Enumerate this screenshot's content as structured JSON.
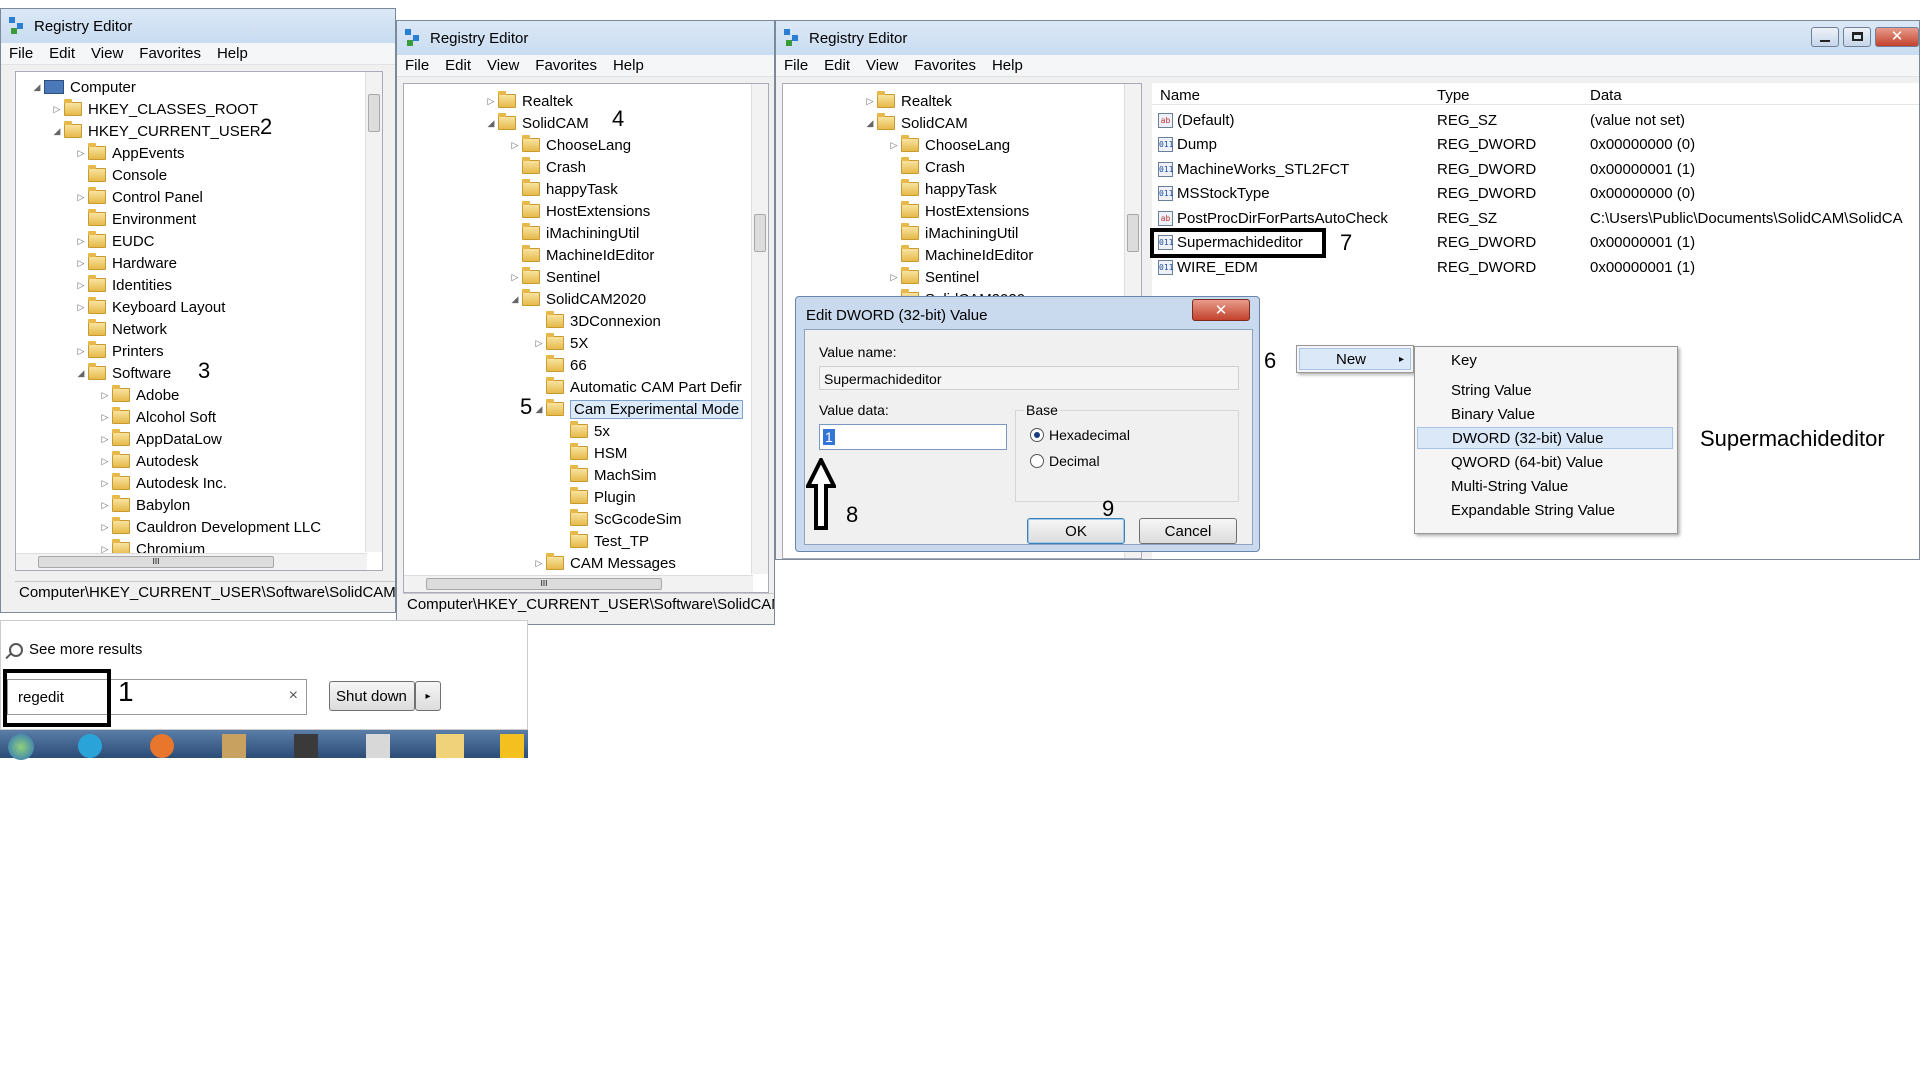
{
  "win1": {
    "title": "Registry Editor",
    "menu": [
      "File",
      "Edit",
      "View",
      "Favorites",
      "Help"
    ],
    "tree": [
      "Computer",
      "HKEY_CLASSES_ROOT",
      "HKEY_CURRENT_USER",
      "AppEvents",
      "Console",
      "Control Panel",
      "Environment",
      "EUDC",
      "Hardware",
      "Identities",
      "Keyboard Layout",
      "Network",
      "Printers",
      "Software",
      "Adobe",
      "Alcohol Soft",
      "AppDataLow",
      "Autodesk",
      "Autodesk Inc.",
      "Babylon",
      "Cauldron Development LLC",
      "Chromium"
    ],
    "status": "Computer\\HKEY_CURRENT_USER\\Software\\SolidCAM\\S",
    "scroll_mark": "III"
  },
  "win2": {
    "title": "Registry Editor",
    "menu": [
      "File",
      "Edit",
      "View",
      "Favorites",
      "Help"
    ],
    "tree": [
      "Realtek",
      "SolidCAM",
      "ChooseLang",
      "Crash",
      "happyTask",
      "HostExtensions",
      "iMachiningUtil",
      "MachineIdEditor",
      "Sentinel",
      "SolidCAM2020",
      "3DConnexion",
      "5X",
      "66",
      "Automatic CAM Part Defir",
      "Cam Experimental Mode",
      "5x",
      "HSM",
      "MachSim",
      "Plugin",
      "ScGcodeSim",
      "Test_TP",
      "CAM Messages"
    ],
    "status": "Computer\\HKEY_CURRENT_USER\\Software\\SolidCAM\\S",
    "scroll_mark": "III"
  },
  "win3": {
    "title": "Registry Editor",
    "menu": [
      "File",
      "Edit",
      "View",
      "Favorites",
      "Help"
    ],
    "tree": [
      "Realtek",
      "SolidCAM",
      "ChooseLang",
      "Crash",
      "happyTask",
      "HostExtensions",
      "iMachiningUtil",
      "MachineIdEditor",
      "Sentinel",
      "SolidCAM2020"
    ],
    "columns": [
      "Name",
      "Type",
      "Data"
    ],
    "values": [
      {
        "icon": "ab",
        "name": "(Default)",
        "type": "REG_SZ",
        "data": "(value not set)"
      },
      {
        "icon": "011",
        "name": "Dump",
        "type": "REG_DWORD",
        "data": "0x00000000 (0)"
      },
      {
        "icon": "011",
        "name": "MachineWorks_STL2FCT",
        "type": "REG_DWORD",
        "data": "0x00000001 (1)"
      },
      {
        "icon": "011",
        "name": "MSStockType",
        "type": "REG_DWORD",
        "data": "0x00000000 (0)"
      },
      {
        "icon": "ab",
        "name": "PostProcDirForPartsAutoCheck",
        "type": "REG_SZ",
        "data": "C:\\Users\\Public\\Documents\\SolidCAM\\SolidCA"
      },
      {
        "icon": "011",
        "name": "Supermachideditor",
        "type": "REG_DWORD",
        "data": "0x00000001 (1)"
      },
      {
        "icon": "011",
        "name": "WIRE_EDM",
        "type": "REG_DWORD",
        "data": "0x00000001 (1)"
      }
    ],
    "caption_buttons": [
      "minimize",
      "maximize",
      "close"
    ]
  },
  "dialog": {
    "title": "Edit DWORD (32-bit) Value",
    "value_name_label": "Value name:",
    "value_name": "Supermachideditor",
    "value_data_label": "Value data:",
    "value_data": "1",
    "base_label": "Base",
    "hex_label": "Hexadecimal",
    "dec_label": "Decimal",
    "ok": "OK",
    "cancel": "Cancel",
    "selected_base": "Hexadecimal"
  },
  "context_menu": {
    "new_label": "New",
    "items": [
      "Key",
      "String Value",
      "Binary Value",
      "DWORD (32-bit) Value",
      "QWORD (64-bit) Value",
      "Multi-String Value",
      "Expandable String Value"
    ],
    "highlighted": "DWORD (32-bit) Value"
  },
  "side_label": "Supermachideditor",
  "startmenu": {
    "see_more": "See more results",
    "search_value": "regedit",
    "shutdown": "Shut down"
  },
  "annotations": [
    "1",
    "2",
    "3",
    "4",
    "5",
    "6",
    "7",
    "8",
    "9"
  ]
}
